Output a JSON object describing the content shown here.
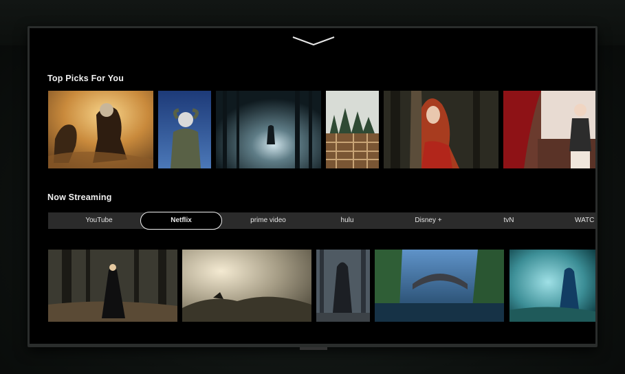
{
  "sections": {
    "top_picks": {
      "title": "Top Picks For You"
    },
    "now_streaming": {
      "title": "Now Streaming"
    }
  },
  "services": [
    {
      "label": "YouTube"
    },
    {
      "label": "Netflix",
      "selected": true
    },
    {
      "label": "prime video"
    },
    {
      "label": "hulu"
    },
    {
      "label": "Disney +"
    },
    {
      "label": "tvN"
    },
    {
      "label": "WATC"
    }
  ],
  "icons": {
    "top_chevron": "chevron-down-icon"
  },
  "colors": {
    "background": "#000000",
    "service_bar": "#2b2b2b",
    "text": "#f1f1f1"
  }
}
